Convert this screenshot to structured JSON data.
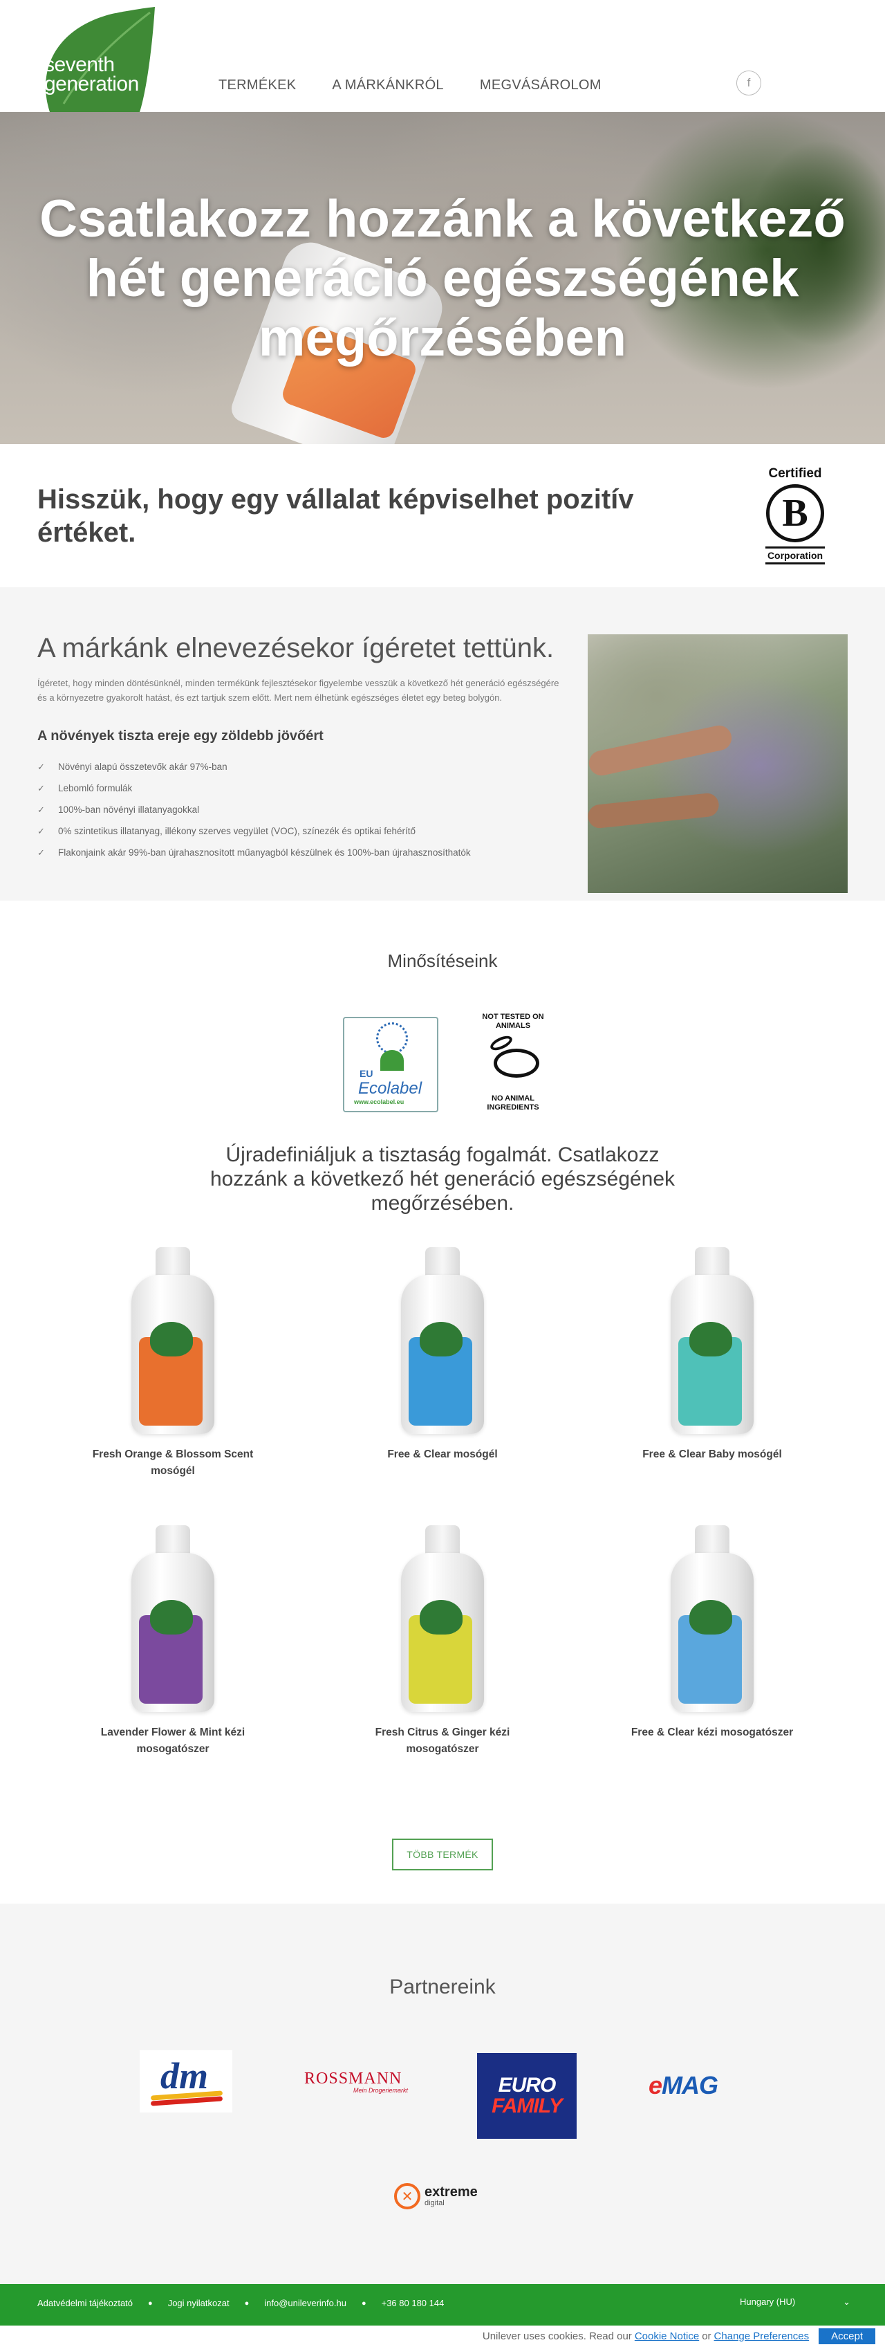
{
  "header": {
    "logo_line1": "seventh",
    "logo_line2": "generation",
    "nav": [
      "TERMÉKEK",
      "A MÁRKÁNKRÓL",
      "MEGVÁSÁROLOM"
    ],
    "social_icon": "facebook-icon",
    "social_glyph": "f"
  },
  "hero": {
    "title": "Csatlakozz hozzánk a következő hét generáció egészségének megőrzésében"
  },
  "belief": {
    "title": "Hisszük, hogy egy vállalat képviselhet pozitív értéket.",
    "badge_top": "Certified",
    "badge_letter": "B",
    "badge_bottom": "Corporation"
  },
  "promise": {
    "title": "A márkánk elnevezésekor ígéretet tettünk.",
    "intro": "Ígéretet, hogy minden döntésünknél, minden termékünk fejlesztésekor figyelembe vesszük a következő hét generáció egészségére és a környezetre gyakorolt hatást, és ezt tartjuk szem előtt. Mert nem élhetünk egészséges életet egy beteg bolygón.",
    "subtitle": "A növények tiszta ereje egy zöldebb jövőért",
    "items": [
      "Növényi alapú összetevők akár 97%-ban",
      "Lebomló formulák",
      "100%-ban növényi illatanyagokkal",
      "0% szintetikus illatanyag, illékony szerves vegyület (VOC), színezék és optikai fehérítő",
      "Flakonjaink akár 99%-ban újrahasznosított műanyagból készülnek és 100%-ban újrahasznosíthatók"
    ]
  },
  "certs": {
    "title": "Minősítéseink",
    "ecolabel_eu": "EU",
    "ecolabel_name": "Ecolabel",
    "ecolabel_url": "www.ecolabel.eu",
    "animals_top": "NOT TESTED ON ANIMALS",
    "animals_bottom": "NO ANIMAL INGREDIENTS"
  },
  "redefine": {
    "text": "Újradefiniáljuk a tisztaság fogalmát. Csatlakozz hozzánk a következő hét generáció egészségének megőrzésében."
  },
  "products": [
    {
      "name": "Fresh Orange & Blossom Scent mosógél",
      "label_color": "#e8702e"
    },
    {
      "name": "Free & Clear mosógél",
      "label_color": "#3a9ad9"
    },
    {
      "name": "Free & Clear Baby mosógél",
      "label_color": "#4fc1b8"
    },
    {
      "name": "Lavender Flower & Mint kézi mosogatószer",
      "label_color": "#7b4a9e"
    },
    {
      "name": "Fresh Citrus & Ginger kézi mosogatószer",
      "label_color": "#d9d63a"
    },
    {
      "name": "Free & Clear kézi mosogatószer",
      "label_color": "#5aa7dd"
    }
  ],
  "more_button": "TÖBB TERMÉK",
  "partners": {
    "title": "Partnereink",
    "dm": "dm",
    "rossmann": "ROSSMANN",
    "rossmann_tagline": "Mein Drogeriemarkt",
    "euro_line1": "EURO",
    "euro_line2": "FAMILY",
    "emag_e": "e",
    "emag_rest": "MAG",
    "extreme": "extreme",
    "extreme_sub": "digital"
  },
  "footer": {
    "links": [
      "Adatvédelmi tájékoztató",
      "Jogi nyilatkozat",
      "info@unileverinfo.hu",
      "+36 80 180 144"
    ],
    "country": "Hungary (HU)",
    "country_icon": "chevron-down-icon"
  },
  "cookie": {
    "text": "Unilever uses cookies. Read our",
    "notice": "Cookie Notice",
    "or": "or",
    "change": "Change Preferences",
    "accept": "Accept"
  }
}
